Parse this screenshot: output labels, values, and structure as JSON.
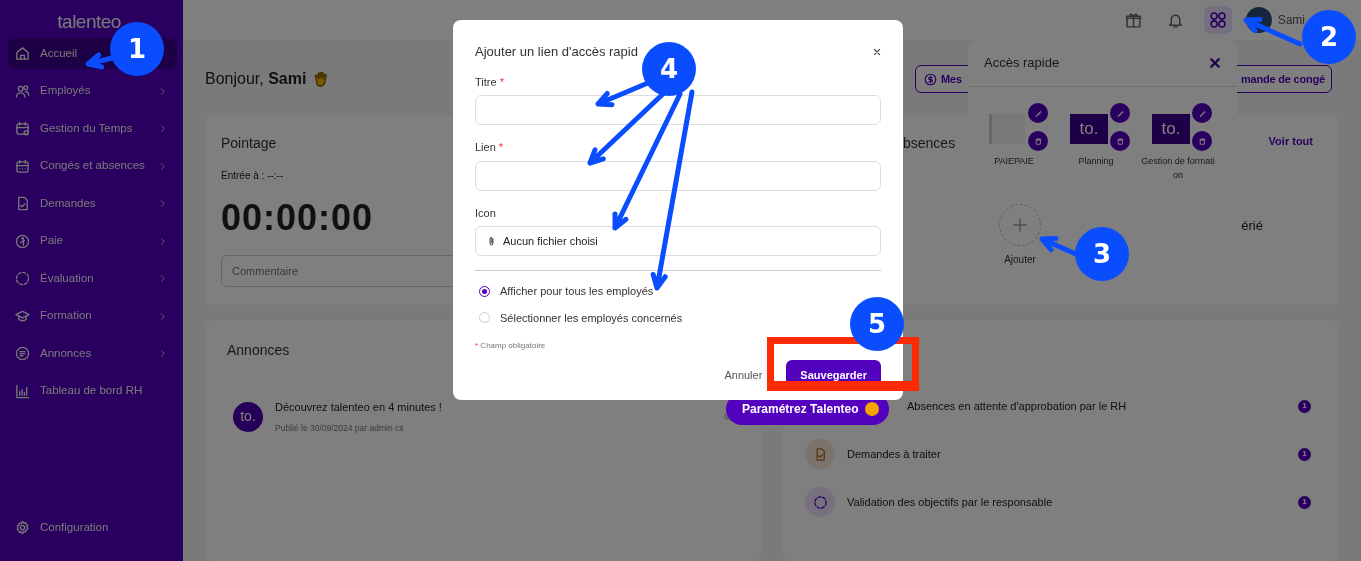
{
  "sidebar": {
    "logo": "talenteo.",
    "items": [
      {
        "label": "Accueil",
        "selected": true,
        "expandable": false
      },
      {
        "label": "Employés",
        "selected": false,
        "expandable": true
      },
      {
        "label": "Gestion du Temps",
        "selected": false,
        "expandable": true
      },
      {
        "label": "Congés et absences",
        "selected": false,
        "expandable": true
      },
      {
        "label": "Demandes",
        "selected": false,
        "expandable": true
      },
      {
        "label": "Paie",
        "selected": false,
        "expandable": true
      },
      {
        "label": "Évaluation",
        "selected": false,
        "expandable": true
      },
      {
        "label": "Formation",
        "selected": false,
        "expandable": true
      },
      {
        "label": "Annonces",
        "selected": false,
        "expandable": true
      },
      {
        "label": "Tableau de bord RH",
        "selected": false,
        "expandable": false
      }
    ],
    "footer_item": {
      "label": "Configuration"
    }
  },
  "topbar": {
    "user_name": "Sami",
    "apps_active": true
  },
  "greeting": {
    "text": "Bonjour, **Sami**"
  },
  "header_buttons": [
    {
      "label": "Mes"
    },
    {
      "label": "mande de congé"
    }
  ],
  "pointage": {
    "title": "Pointage",
    "entry": "Entrée à : --:--",
    "timer": "00:00:00",
    "comment_placeholder": "Commentaire"
  },
  "absences_card": {
    "title": "bsences",
    "link": "Voir tout",
    "row_text": "érié"
  },
  "announcements": {
    "title": "Annonces",
    "items": [
      {
        "logo": "to.",
        "title": "Découvrez talenteo en 4 minutes !",
        "meta": "Publié le 30/09/2024 par admin cs"
      }
    ]
  },
  "tasks": [
    {
      "label": "Absences en attente d'approbation par le RH",
      "count": "1"
    },
    {
      "label": "Demandes à traiter",
      "count": "1"
    },
    {
      "label": "Validation des objectifs par le responsable",
      "count": "1"
    }
  ],
  "quick_access": {
    "title": "Accès rapide",
    "links": [
      {
        "kind": "image",
        "label": "PAIEPAIE"
      },
      {
        "kind": "logo",
        "logo": "to.",
        "label": "Planning"
      },
      {
        "kind": "logo",
        "logo": "to.",
        "label": "Gestion de formation"
      }
    ],
    "add_label": "Ajouter"
  },
  "floating_button": {
    "label": "Paramétrez Talenteo"
  },
  "modal": {
    "title": "Ajouter un lien d'accès rapid",
    "required_mark": "*",
    "fields": [
      {
        "kind": "text",
        "label": "Titre",
        "required": true
      },
      {
        "kind": "text",
        "label": "Lien",
        "required": true
      },
      {
        "kind": "file",
        "label": "Icon",
        "value": "Aucun fichier choisi",
        "required": false
      }
    ],
    "options": [
      {
        "label": "Afficher pour tous les employés",
        "selected": true
      },
      {
        "label": "Sélectionner les employés concernés",
        "selected": false
      }
    ],
    "required_note": "Champ obligatoire",
    "cancel": "Annuler",
    "save": "Sauvegarder"
  },
  "annotations": [
    {
      "label": "1"
    },
    {
      "label": "2"
    },
    {
      "label": "3"
    },
    {
      "label": "4"
    },
    {
      "label": "5"
    }
  ]
}
